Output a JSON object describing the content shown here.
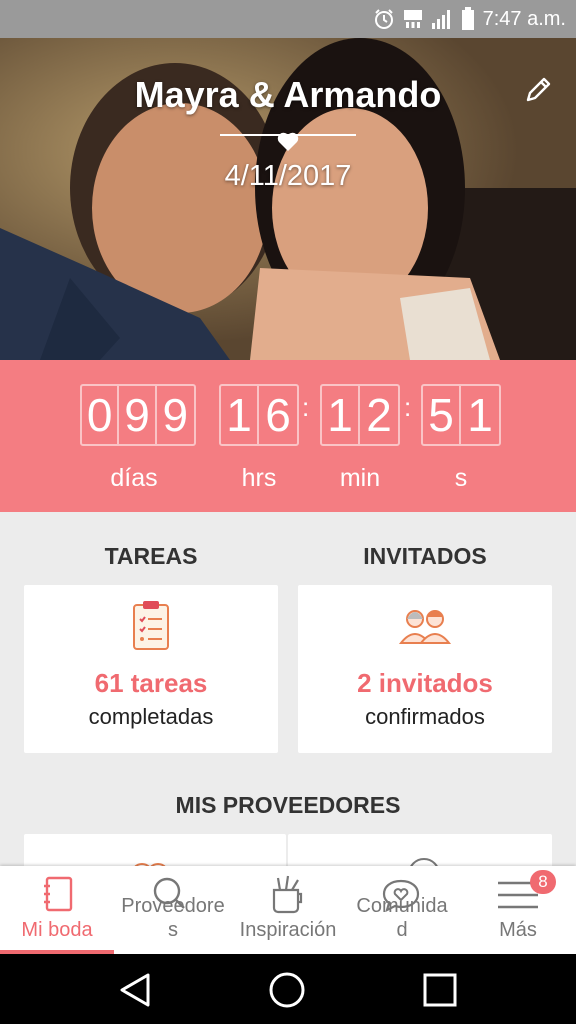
{
  "status_bar": {
    "time": "7:47 a.m.",
    "icons": [
      "alarm-icon",
      "4g-icon",
      "signal-icon",
      "battery-icon"
    ]
  },
  "hero": {
    "couple_names": "Mayra & Armando",
    "wedding_date": "4/11/2017"
  },
  "countdown": {
    "days": {
      "digits": [
        "0",
        "9",
        "9"
      ],
      "label": "días"
    },
    "hours": {
      "digits": [
        "1",
        "6"
      ],
      "label": "hrs"
    },
    "minutes": {
      "digits": [
        "1",
        "2"
      ],
      "label": "min"
    },
    "seconds": {
      "digits": [
        "5",
        "1"
      ],
      "label": "s"
    }
  },
  "tasks": {
    "title": "TAREAS",
    "count": "61 tareas",
    "subtitle": "completadas"
  },
  "guests": {
    "title": "INVITADOS",
    "count": "2 invitados",
    "subtitle": "confirmados"
  },
  "vendors": {
    "title": "MIS PROVEEDORES"
  },
  "bottom_nav": {
    "items": [
      {
        "label": "Mi boda",
        "icon": "notebook-icon"
      },
      {
        "label": "Proveedore\ns",
        "icon": "search-icon"
      },
      {
        "label": "Inspiración",
        "icon": "inspiration-icon"
      },
      {
        "label": "Comunida\nd",
        "icon": "chat-heart-icon"
      },
      {
        "label": "Más",
        "icon": "menu-icon"
      }
    ],
    "badge": "8"
  },
  "colors": {
    "accent": "#f47d82",
    "accent_text": "#f06a70"
  }
}
